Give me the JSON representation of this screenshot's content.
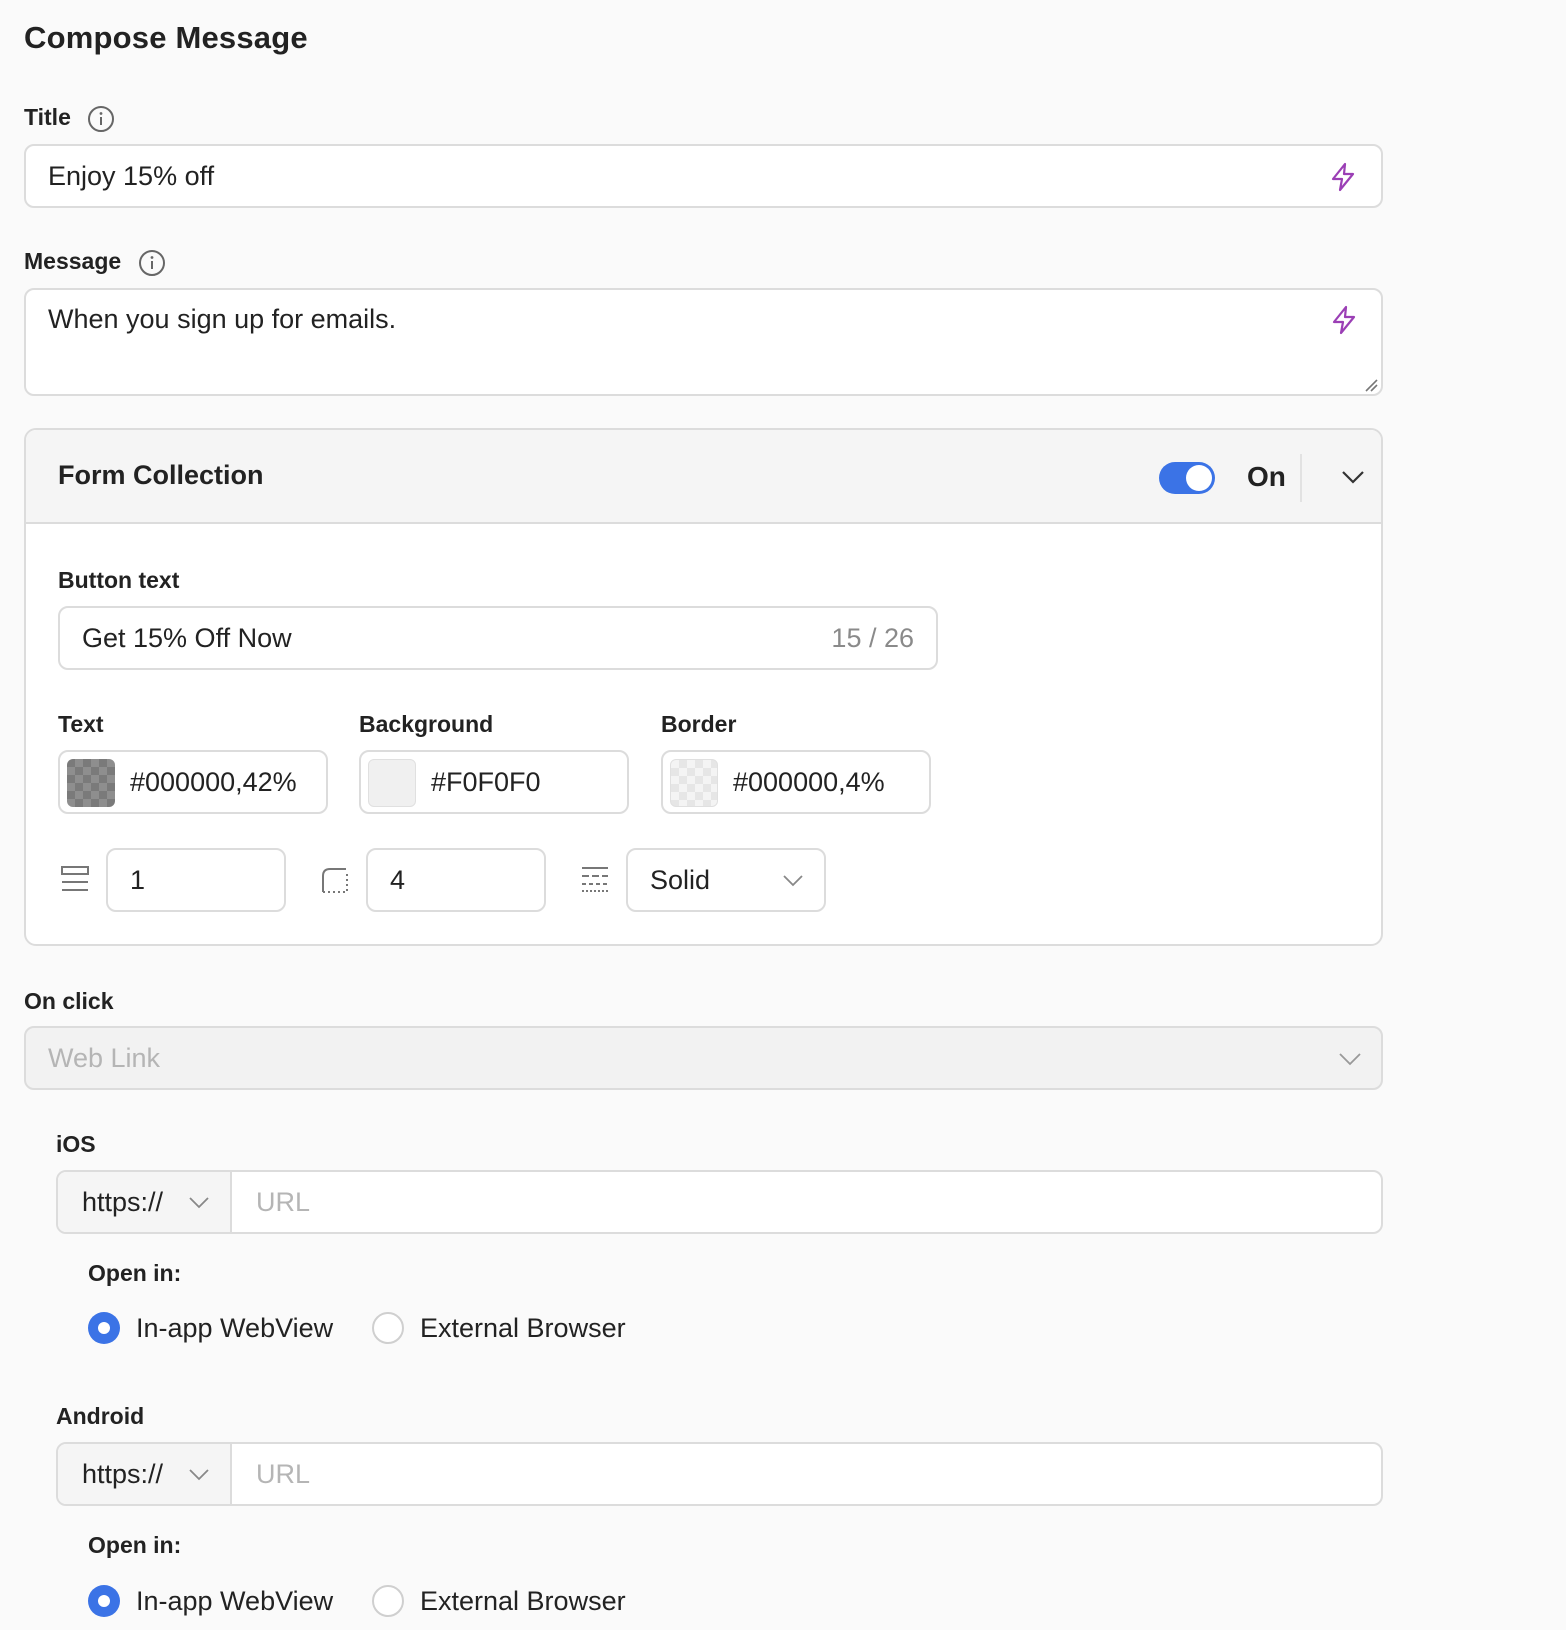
{
  "page": {
    "heading": "Compose Message"
  },
  "title_field": {
    "label": "Title",
    "value": "Enjoy 15% off"
  },
  "message_field": {
    "label": "Message",
    "value": "When you sign up for emails."
  },
  "form_collection": {
    "title": "Form Collection",
    "toggle_state": "On",
    "toggle_color": "#3b73e6",
    "button_text": {
      "label": "Button text",
      "value": "Get 15% Off Now",
      "counter": "15 / 26"
    },
    "colors": {
      "text": {
        "label": "Text",
        "value": "#000000,42%"
      },
      "background": {
        "label": "Background",
        "value": "#F0F0F0"
      },
      "border": {
        "label": "Border",
        "value": "#000000,4%"
      }
    },
    "border_width": "1",
    "border_radius": "4",
    "border_style": "Solid"
  },
  "on_click": {
    "label": "On click",
    "value": "Web Link"
  },
  "ios": {
    "label": "iOS",
    "protocol": "https://",
    "url_placeholder": "URL",
    "open_in_label": "Open in:",
    "options": [
      "In-app WebView",
      "External Browser"
    ],
    "selected": "In-app WebView"
  },
  "android": {
    "label": "Android",
    "protocol": "https://",
    "url_placeholder": "URL",
    "open_in_label": "Open in:",
    "options": [
      "In-app WebView",
      "External Browser"
    ],
    "selected": "In-app WebView"
  },
  "accent_color": "#9b3fb5"
}
